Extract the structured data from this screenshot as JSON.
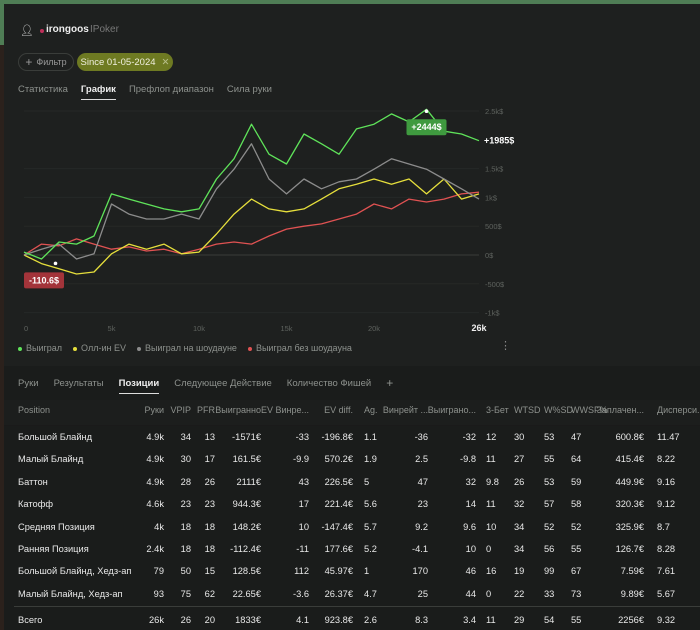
{
  "header": {
    "username": "irongoos",
    "site": "IPoker",
    "filter_label": "Фильтр",
    "date_chip": "Since 01-05-2024"
  },
  "top_tabs": [
    {
      "label": "Статистика"
    },
    {
      "label": "График",
      "active": true
    },
    {
      "label": "Префлоп диапазон"
    },
    {
      "label": "Сила руки"
    }
  ],
  "chart_data": {
    "type": "line",
    "x_unit": "hands",
    "x": [
      0,
      1000,
      2000,
      3000,
      4000,
      5000,
      6000,
      7000,
      8000,
      9000,
      10000,
      11000,
      12000,
      13000,
      14000,
      15000,
      16000,
      17000,
      18000,
      19000,
      20000,
      21000,
      22000,
      23000,
      24000,
      25000,
      26000
    ],
    "xlim": [
      0,
      26000
    ],
    "ylim": [
      -1000,
      2500
    ],
    "x_ticks": [
      {
        "v": 0,
        "label": "0"
      },
      {
        "v": 5000,
        "label": "5k"
      },
      {
        "v": 10000,
        "label": "10k"
      },
      {
        "v": 15000,
        "label": "15k"
      },
      {
        "v": 20000,
        "label": "20k"
      },
      {
        "v": 26000,
        "label": "26k",
        "bold": true
      }
    ],
    "y_ticks": [
      {
        "v": 2500,
        "label": "2.5k$"
      },
      {
        "v": 1500,
        "label": "1.5k$"
      },
      {
        "v": 1000,
        "label": "1k$"
      },
      {
        "v": 500,
        "label": "500$"
      },
      {
        "v": 0,
        "label": "0$"
      },
      {
        "v": -500,
        "label": "-500$"
      },
      {
        "v": -1000,
        "label": "-1k$"
      }
    ],
    "series": [
      {
        "name": "Выиграл",
        "color": "#5fe35a",
        "values": [
          50,
          -70,
          225,
          190,
          330,
          1060,
          970,
          885,
          800,
          750,
          800,
          1320,
          1670,
          2270,
          1750,
          1580,
          2100,
          1930,
          1750,
          2190,
          2270,
          2450,
          2310,
          2530,
          2150,
          2100,
          1985
        ]
      },
      {
        "name": "Олл-ин EV",
        "color": "#e6df3c",
        "values": [
          0,
          -150,
          -240,
          -330,
          -295,
          20,
          190,
          100,
          190,
          20,
          50,
          365,
          710,
          970,
          800,
          750,
          800,
          970,
          1150,
          1230,
          1320,
          1230,
          1320,
          1060,
          1320,
          970,
          1060
        ]
      },
      {
        "name": "Выиграл на шоудауне",
        "color": "#8c8c8c",
        "values": [
          0,
          100,
          190,
          -70,
          20,
          885,
          710,
          625,
          625,
          710,
          625,
          1150,
          1490,
          1930,
          1320,
          1060,
          1320,
          1150,
          1270,
          1320,
          1490,
          1670,
          1580,
          1490,
          1320,
          1150,
          970
        ]
      },
      {
        "name": "Выиграл без шоудауна",
        "color": "#e05252",
        "values": [
          0,
          190,
          160,
          280,
          190,
          100,
          140,
          70,
          100,
          20,
          100,
          190,
          225,
          190,
          330,
          450,
          500,
          540,
          625,
          710,
          885,
          800,
          970,
          920,
          970,
          1060,
          1090
        ]
      }
    ],
    "annotations": {
      "max_label": "+2444$",
      "max": {
        "x": 23000,
        "y": 2444
      },
      "min_label": "-110.6$",
      "min": {
        "x": 1000,
        "y": -110.6
      },
      "last_label": "+1985$"
    }
  },
  "legend": [
    {
      "label": "Выиграл",
      "color": "#5fe35a"
    },
    {
      "label": "Олл-ин EV",
      "color": "#e6df3c"
    },
    {
      "label": "Выиграл на шоудауне",
      "color": "#8c8c8c"
    },
    {
      "label": "Выиграл без шоудауна",
      "color": "#e05252"
    }
  ],
  "sub_tabs": [
    {
      "label": "Руки"
    },
    {
      "label": "Результаты"
    },
    {
      "label": "Позиции",
      "active": true
    },
    {
      "label": "Следующее Действие"
    },
    {
      "label": "Количество Фишей"
    },
    {
      "label": "+"
    }
  ],
  "table": {
    "columns": [
      "Position",
      "Руки",
      "VPIP",
      "PFR",
      "Выигранно",
      "EV Винре...",
      "EV diff.",
      "Ag.",
      "Винрейт ...",
      "Выиграно...",
      "3-Бет",
      "WTSD",
      "W%SD",
      "WWSF%",
      "Заплачен...",
      "Дисперси..."
    ],
    "rows": [
      [
        "Большой Блайнд",
        "4.9k",
        "34",
        "13",
        "-1571€",
        "-33",
        "-196.8€",
        "1.1",
        "-36",
        "-32",
        "12",
        "30",
        "53",
        "47",
        "600.8€",
        "11.47"
      ],
      [
        "Малый Блайнд",
        "4.9k",
        "30",
        "17",
        "161.5€",
        "-9.9",
        "570.2€",
        "1.9",
        "2.5",
        "-9.8",
        "11",
        "27",
        "55",
        "64",
        "415.4€",
        "8.22"
      ],
      [
        "Баттон",
        "4.9k",
        "28",
        "26",
        "2111€",
        "43",
        "226.5€",
        "5",
        "47",
        "32",
        "9.8",
        "26",
        "53",
        "59",
        "449.9€",
        "9.16"
      ],
      [
        "Катофф",
        "4.6k",
        "23",
        "23",
        "944.3€",
        "17",
        "221.4€",
        "5.6",
        "23",
        "14",
        "11",
        "32",
        "57",
        "58",
        "320.3€",
        "9.12"
      ],
      [
        "Средняя Позиция",
        "4k",
        "18",
        "18",
        "148.2€",
        "10",
        "-147.4€",
        "5.7",
        "9.2",
        "9.6",
        "10",
        "34",
        "52",
        "52",
        "325.9€",
        "8.7"
      ],
      [
        "Ранняя Позиция",
        "2.4k",
        "18",
        "18",
        "-112.4€",
        "-11",
        "177.6€",
        "5.2",
        "-4.1",
        "10",
        "0",
        "34",
        "56",
        "55",
        "126.7€",
        "8.28"
      ],
      [
        "Большой Блайнд, Хедз-ап",
        "79",
        "50",
        "15",
        "128.5€",
        "112",
        "45.97€",
        "1",
        "170",
        "46",
        "16",
        "19",
        "99",
        "67",
        "7.59€",
        "7.61"
      ],
      [
        "Малый Блайнд, Хедз-ап",
        "93",
        "75",
        "62",
        "22.65€",
        "-3.6",
        "26.37€",
        "4.7",
        "25",
        "44",
        "0",
        "22",
        "33",
        "73",
        "9.89€",
        "5.67"
      ]
    ],
    "total": [
      "Всего",
      "26k",
      "26",
      "20",
      "1833€",
      "4.1",
      "923.8€",
      "2.6",
      "8.3",
      "3.4",
      "11",
      "29",
      "54",
      "55",
      "2256€",
      "9.32"
    ]
  }
}
